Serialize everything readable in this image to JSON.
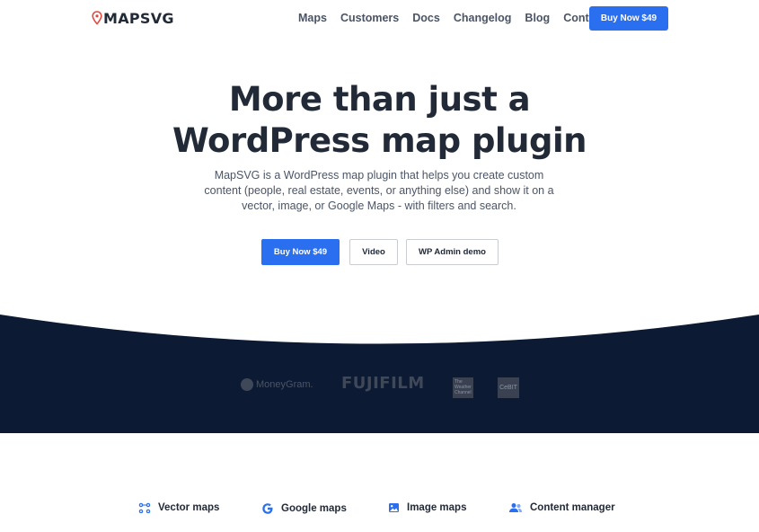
{
  "header": {
    "logo_text": "MAPSVG",
    "nav": [
      "Maps",
      "Customers",
      "Docs",
      "Changelog",
      "Blog",
      "Contact"
    ],
    "buy_label": "Buy Now $49"
  },
  "hero": {
    "title_line1": "More than just a",
    "title_line2": "WordPress map plugin",
    "description": "MapSVG is a WordPress map plugin that helps you create custom content (people, real estate, events, or anything else) and show it on a vector, image, or Google Maps - with filters and search.",
    "buttons": {
      "buy": "Buy Now $49",
      "video": "Video",
      "demo": "WP Admin demo"
    }
  },
  "brands": {
    "moneygram": "MoneyGram.",
    "fujifilm": "FUJIFILM",
    "weather": "The Weather Channel",
    "cebit": "CeBIT"
  },
  "features": [
    {
      "label": "Vector maps",
      "icon": "vector-maps-icon"
    },
    {
      "label": "Google maps",
      "icon": "google-icon"
    },
    {
      "label": "Image maps",
      "icon": "image-icon"
    },
    {
      "label": "Content manager",
      "icon": "users-icon"
    }
  ],
  "colors": {
    "accent": "#2a6ff0",
    "dark_band": "#0d1a33",
    "logo_pin": "#e8473d"
  }
}
